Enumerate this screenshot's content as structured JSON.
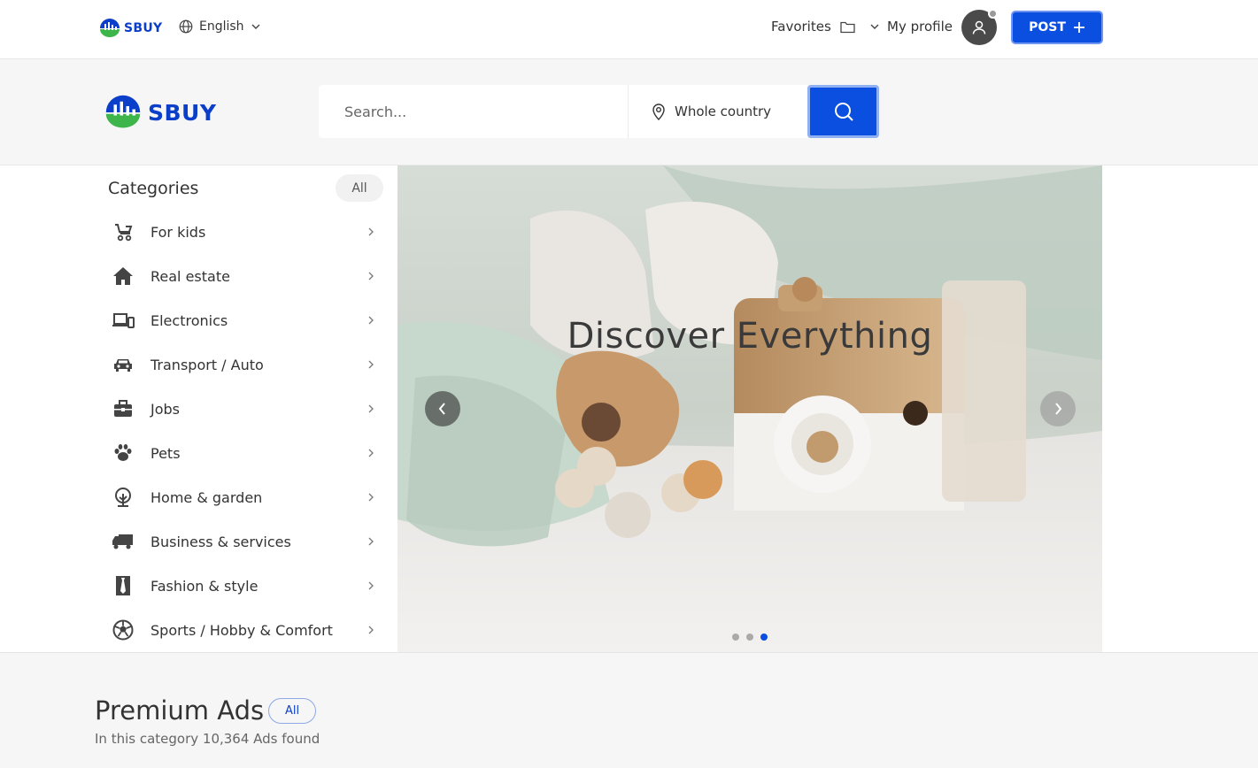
{
  "header": {
    "logo_text": "SBUY",
    "language": "English",
    "favorites_label": "Favorites",
    "profile_label": "My profile",
    "post_label": "POST"
  },
  "search": {
    "placeholder": "Search...",
    "location": "Whole country"
  },
  "categories": {
    "title": "Categories",
    "all_label": "All",
    "items": [
      {
        "label": "For kids",
        "icon": "stroller-icon"
      },
      {
        "label": "Real estate",
        "icon": "house-icon"
      },
      {
        "label": "Electronics",
        "icon": "devices-icon"
      },
      {
        "label": "Transport / Auto",
        "icon": "car-icon"
      },
      {
        "label": "Jobs",
        "icon": "briefcase-icon"
      },
      {
        "label": "Pets",
        "icon": "paw-icon"
      },
      {
        "label": "Home & garden",
        "icon": "tree-icon"
      },
      {
        "label": "Business & services",
        "icon": "truck-icon"
      },
      {
        "label": "Fashion & style",
        "icon": "tie-icon"
      },
      {
        "label": "Sports / Hobby & Comfort",
        "icon": "soccer-ball-icon"
      }
    ]
  },
  "slider": {
    "title": "Discover Everything",
    "slide_count": 3,
    "active_slide": 3
  },
  "premium": {
    "title": "Premium Ads",
    "all_label": "All",
    "subtitle": "In this category 10,364 Ads found"
  },
  "colors": {
    "brand_blue": "#0b4fe0",
    "logo_green": "#3db54a"
  }
}
